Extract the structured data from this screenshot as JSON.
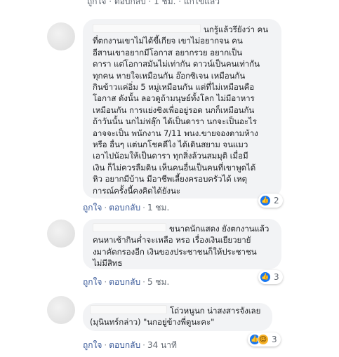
{
  "top_partial": "ถูกใจ · ตอบกลับ · 1 ชม. · แก้ไขแล้ว",
  "comments": [
    {
      "lines": [
        "นกรู้แล้วรึยังว่า คน",
        "ที่ตกงานเขาไม่ได้ขี้เกียจ เขาไม่อยากจน คน",
        "อีสานเขาอยากมีโอกาส อยากรวย อยากเป็น",
        "ดารา แต่โอกาสมันไม่เท่ากัน ดาวน์เป็นคนเท่ากัน",
        "ทุกคน หายใจเหมือนกัน อ๊อกซิเจน เหมือนกัน",
        "กินข้าวแค่อิ่ม 5 หมู่เหมือนกัน แต่ที่ไม่เหมือนคือ",
        "โอกาส ดังนั้น ลอวดูถ้ามนุษย์ทั้งโลก ไม่มีอาหาร",
        "เหมือนกัน การแย่งชิงเพื่ออยู่รอด นกก็เหมือนกัน",
        "ถ้าวันนั้น นกไม่ฟลุ๊ก ได้เป็นดารา นกจะเป็นอะไร",
        "อาจจะเป็น พนักงาน 7/11 พนง.ขายจองตามห้าง",
        "หรือ อื่นๆ แต่นกโชคดีไง ได้เดินสยาม จนแมว",
        "เอาไปน้อมให้เป็นดารา ทุกสิ่งล้วนสมมุติ เมื่อมี",
        "เงิน ก็ไม่ควรลืมดิน เห็นคนอื่นเป็นคนที่เขาพูดได้",
        "หิว อยากมีบ้าน มีอาชีพเลี้ยงครอบครัวได้ เหตุ",
        "การณ์ครั้งนี้คงคิดได้ยังนะ"
      ],
      "actions": {
        "like": "ถูกใจ",
        "reply": "ตอบกลับ",
        "time": "1 ชม."
      },
      "reaction_count": "2",
      "reaction_icons": [
        "like-icon"
      ]
    },
    {
      "lines": [
        "ขนาดนักแสดง ยังตกงานแล้ว",
        "คนหาเช้ากินค่ำจะเหลือ หรอ เรื่องเงินเยียวยายั",
        "งมาคัดกรองอีก เงินของประชาชนก็ให้ประชาชน",
        "ไม่มีสิทธ"
      ],
      "actions": {
        "like": "ถูกใจ",
        "reply": "ตอบกลับ",
        "time": "5 ชม."
      },
      "reaction_count": "3",
      "reaction_icons": [
        "like-icon"
      ]
    },
    {
      "lines": [
        "โถ่วหนูนก น่าสงสารจังเลย",
        "(มุนินทร์กล่าว) \"นกอยู่ข้างพี่ตูนะคะ\""
      ],
      "actions": {
        "like": "ถูกใจ",
        "reply": "ตอบกลับ",
        "time": "34 นาที"
      },
      "reaction_count": "3",
      "reaction_icons": [
        "like-icon",
        "haha-icon"
      ]
    }
  ],
  "colors": {
    "link": "#385898",
    "bubble": "#f2f3f5",
    "like": "#1877f2",
    "haha": "#f7b125"
  }
}
